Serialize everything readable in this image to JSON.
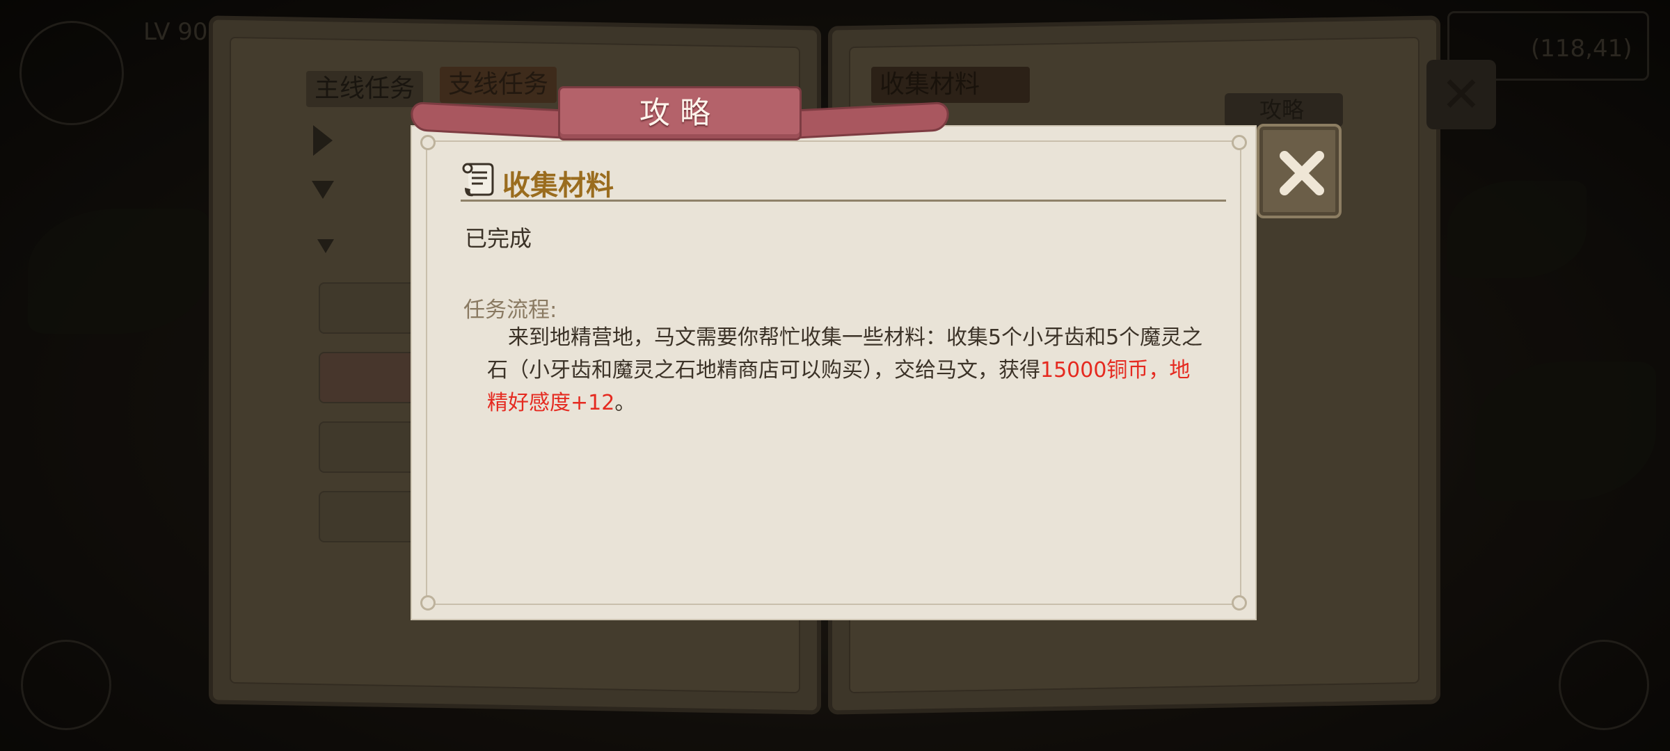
{
  "background": {
    "tabs": [
      "主线任务",
      "支线任务",
      "收集材料"
    ],
    "guide_label": "攻略",
    "coords": "(118,41)"
  },
  "dialog": {
    "banner_title": "攻略",
    "section_title": "收集材料",
    "status": "已完成",
    "flow_label": "任务流程:",
    "description_plain": "来到地精营地，马文需要你帮忙收集一些材料：收集5个小牙齿和5个魔灵之石（小牙齿和魔灵之石地精商店可以购买），交给马文，获得",
    "description_reward": "15000铜币，地精好感度+12",
    "description_end": "。",
    "close_label": "✕"
  },
  "colors": {
    "accent_title": "#9a6c1e",
    "reward_red": "#e52a20",
    "banner": "#b4626a",
    "parchment": "#e9e3d7"
  },
  "icons": [
    "scroll-icon",
    "close-icon"
  ]
}
